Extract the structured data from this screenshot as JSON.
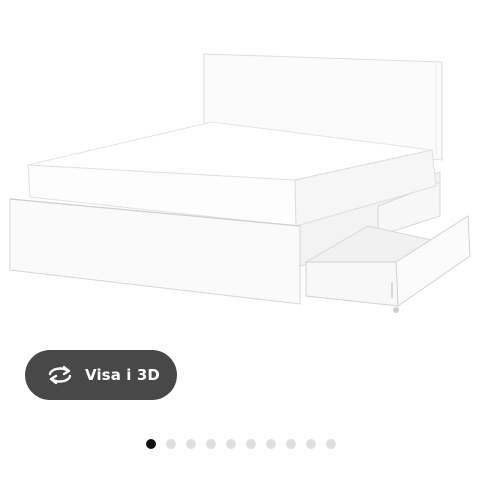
{
  "product_image": {
    "subject": "bed-frame-with-storage-drawers"
  },
  "view_3d_button": {
    "label": "Visa i 3D",
    "icon": "rotate-3d-icon",
    "background": "#484848",
    "text_color": "#ffffff"
  },
  "carousel": {
    "total_slides": 10,
    "active_index": 0,
    "active_color": "#111111",
    "inactive_color": "#dfdfdf"
  }
}
